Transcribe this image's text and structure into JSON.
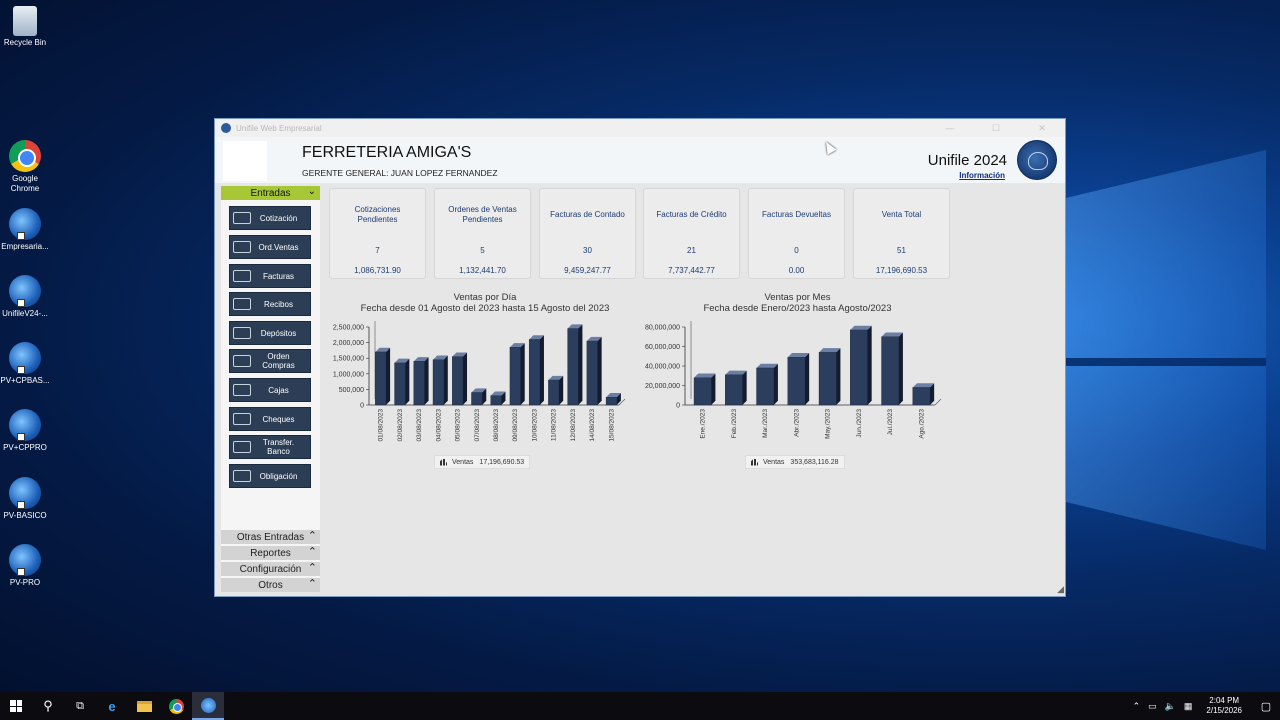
{
  "desktop": {
    "icons": [
      {
        "label": "Recycle Bin",
        "icon": "recycle-bin-icon"
      },
      {
        "label": "Google Chrome",
        "icon": "chrome-icon"
      },
      {
        "label": "Empresaria...",
        "icon": "unifile-app-icon"
      },
      {
        "label": "UnifileV24-...",
        "icon": "unifile-app-icon"
      },
      {
        "label": "PV+CPBAS...",
        "icon": "unifile-app-icon"
      },
      {
        "label": "PV+CPPRO",
        "icon": "unifile-app-icon"
      },
      {
        "label": "PV-BASICO",
        "icon": "unifile-app-icon"
      },
      {
        "label": "PV-PRO",
        "icon": "unifile-app-icon"
      }
    ]
  },
  "window": {
    "title": "Unifile Web Empresarial",
    "controls": {
      "minimize": "—",
      "maximize": "☐",
      "close": "✕"
    }
  },
  "header": {
    "company": "FERRETERIA AMIGA'S",
    "manager": "GERENTE GENERAL: JUAN LOPEZ FERNANDEZ",
    "brand": "Unifile 2024",
    "info_link": "Información"
  },
  "sidebar": {
    "section": "Entradas",
    "items": [
      {
        "label": "Cotización"
      },
      {
        "label": "Ord.Ventas"
      },
      {
        "label": "Facturas"
      },
      {
        "label": "Recibos"
      },
      {
        "label": "Depósitos"
      },
      {
        "label": "Orden Compras"
      },
      {
        "label": "Cajas"
      },
      {
        "label": "Cheques"
      },
      {
        "label": "Transfer. Banco"
      },
      {
        "label": "Obligación"
      }
    ],
    "collapsed_sections": [
      {
        "label": "Otras Entradas"
      },
      {
        "label": "Reportes"
      },
      {
        "label": "Configuración"
      },
      {
        "label": "Otros"
      }
    ]
  },
  "kpis": [
    {
      "title": "Cotizaciones Pendientes",
      "count": "7",
      "amount": "1,086,731.90"
    },
    {
      "title": "Ordenes de Ventas Pendientes",
      "count": "5",
      "amount": "1,132,441.70"
    },
    {
      "title": "Facturas de Contado",
      "count": "30",
      "amount": "9,459,247.77"
    },
    {
      "title": "Facturas de Crédito",
      "count": "21",
      "amount": "7,737,442.77"
    },
    {
      "title": "Facturas Devueltas",
      "count": "0",
      "amount": "0.00"
    },
    {
      "title": "Venta Total",
      "count": "51",
      "amount": "17,196,690.53"
    }
  ],
  "chart_data": [
    {
      "type": "bar",
      "title": "Ventas por Día",
      "subtitle": "Fecha desde 01 Agosto del 2023 hasta 15 Agosto del 2023",
      "categories": [
        "01/08/2023",
        "02/08/2023",
        "03/08/2023",
        "04/08/2023",
        "05/08/2023",
        "07/08/2023",
        "08/08/2023",
        "09/08/2023",
        "10/08/2023",
        "11/08/2023",
        "12/08/2023",
        "14/08/2023",
        "15/08/2023"
      ],
      "series": [
        {
          "name": "Ventas",
          "values": [
            1700000,
            1350000,
            1400000,
            1450000,
            1550000,
            400000,
            300000,
            1850000,
            2100000,
            800000,
            2450000,
            2050000,
            250000
          ]
        }
      ],
      "ylim": [
        0,
        2500000
      ],
      "yticks": [
        "2,500,000",
        "2,000,000",
        "1,500,000",
        "1,000,000",
        "500,000",
        "0"
      ],
      "legend": {
        "name": "Ventas",
        "total": "17,196,690.53"
      },
      "bar_color": "#2c3e5e"
    },
    {
      "type": "bar",
      "title": "Ventas por Mes",
      "subtitle": "Fecha desde Enero/2023 hasta Agosto/2023",
      "categories": [
        "Ene./2023",
        "Feb./2023",
        "Mar./2023",
        "Abr./2023",
        "May./2023",
        "Jun./2023",
        "Jul./2023",
        "Ago./2023"
      ],
      "series": [
        {
          "name": "Ventas",
          "values": [
            28000000,
            31000000,
            38000000,
            49000000,
            54000000,
            77000000,
            70000000,
            18000000
          ]
        }
      ],
      "ylim": [
        0,
        80000000
      ],
      "yticks": [
        "80,000,000",
        "60,000,000",
        "40,000,000",
        "20,000,000",
        "0"
      ],
      "legend": {
        "name": "Ventas",
        "total": "353,683,116.28"
      },
      "bar_color": "#2c3e5e"
    }
  ],
  "taskbar": {
    "time": "2:04 PM",
    "date": "2/15/2026"
  }
}
